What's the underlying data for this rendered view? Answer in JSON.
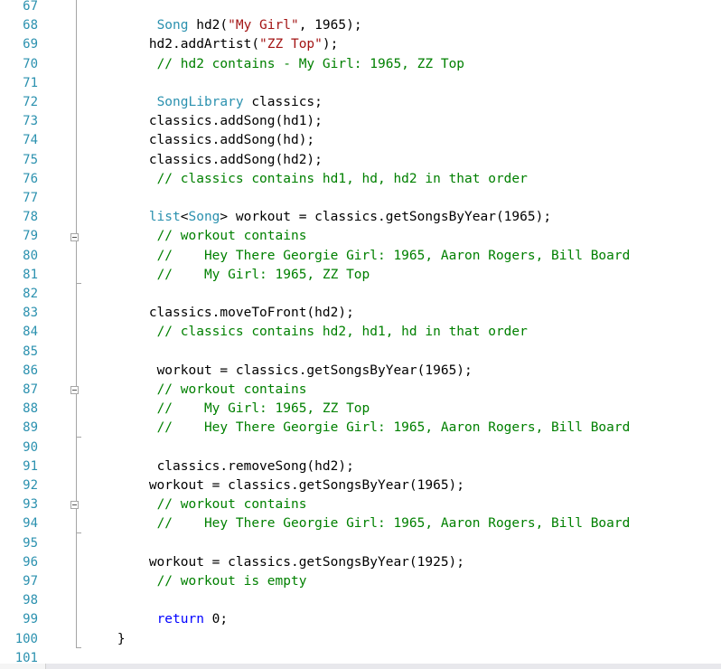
{
  "editor": {
    "lines": [
      {
        "n": "67",
        "indent": 0,
        "tokens": []
      },
      {
        "n": "68",
        "indent": 9,
        "tokens": [
          {
            "t": "Song",
            "c": "ty"
          },
          {
            "t": " hd2(",
            "c": ""
          },
          {
            "t": "\"My Girl\"",
            "c": "str"
          },
          {
            "t": ", 1965);",
            "c": ""
          }
        ]
      },
      {
        "n": "69",
        "indent": 8,
        "tokens": [
          {
            "t": "hd2.addArtist(",
            "c": ""
          },
          {
            "t": "\"ZZ Top\"",
            "c": "str"
          },
          {
            "t": ");",
            "c": ""
          }
        ]
      },
      {
        "n": "70",
        "indent": 9,
        "tokens": [
          {
            "t": "// hd2 contains - My Girl: 1965, ZZ Top",
            "c": "cm"
          }
        ]
      },
      {
        "n": "71",
        "indent": 0,
        "tokens": []
      },
      {
        "n": "72",
        "indent": 9,
        "tokens": [
          {
            "t": "SongLibrary",
            "c": "ty"
          },
          {
            "t": " classics;",
            "c": ""
          }
        ]
      },
      {
        "n": "73",
        "indent": 8,
        "tokens": [
          {
            "t": "classics.addSong(hd1);",
            "c": ""
          }
        ]
      },
      {
        "n": "74",
        "indent": 8,
        "tokens": [
          {
            "t": "classics.addSong(hd);",
            "c": ""
          }
        ]
      },
      {
        "n": "75",
        "indent": 8,
        "tokens": [
          {
            "t": "classics.addSong(hd2);",
            "c": ""
          }
        ]
      },
      {
        "n": "76",
        "indent": 9,
        "tokens": [
          {
            "t": "// classics contains hd1, hd, hd2 in that order",
            "c": "cm"
          }
        ]
      },
      {
        "n": "77",
        "indent": 0,
        "tokens": []
      },
      {
        "n": "78",
        "indent": 8,
        "tokens": [
          {
            "t": "list",
            "c": "ty"
          },
          {
            "t": "<",
            "c": ""
          },
          {
            "t": "Song",
            "c": "ty"
          },
          {
            "t": "> workout = classics.getSongsByYear(1965);",
            "c": ""
          }
        ]
      },
      {
        "n": "79",
        "indent": 9,
        "tokens": [
          {
            "t": "// workout contains",
            "c": "cm"
          }
        ]
      },
      {
        "n": "80",
        "indent": 9,
        "tokens": [
          {
            "t": "//    Hey There Georgie Girl: 1965, Aaron Rogers, Bill Board",
            "c": "cm"
          }
        ]
      },
      {
        "n": "81",
        "indent": 9,
        "tokens": [
          {
            "t": "//    My Girl: 1965, ZZ Top",
            "c": "cm"
          }
        ]
      },
      {
        "n": "82",
        "indent": 0,
        "tokens": []
      },
      {
        "n": "83",
        "indent": 8,
        "tokens": [
          {
            "t": "classics.moveToFront(hd2);",
            "c": ""
          }
        ]
      },
      {
        "n": "84",
        "indent": 9,
        "tokens": [
          {
            "t": "// classics contains hd2, hd1, hd in that order",
            "c": "cm"
          }
        ]
      },
      {
        "n": "85",
        "indent": 0,
        "tokens": []
      },
      {
        "n": "86",
        "indent": 9,
        "tokens": [
          {
            "t": "workout = classics.getSongsByYear(1965);",
            "c": ""
          }
        ]
      },
      {
        "n": "87",
        "indent": 9,
        "tokens": [
          {
            "t": "// workout contains",
            "c": "cm"
          }
        ]
      },
      {
        "n": "88",
        "indent": 9,
        "tokens": [
          {
            "t": "//    My Girl: 1965, ZZ Top",
            "c": "cm"
          }
        ]
      },
      {
        "n": "89",
        "indent": 9,
        "tokens": [
          {
            "t": "//    Hey There Georgie Girl: 1965, Aaron Rogers, Bill Board",
            "c": "cm"
          }
        ]
      },
      {
        "n": "90",
        "indent": 0,
        "tokens": []
      },
      {
        "n": "91",
        "indent": 9,
        "tokens": [
          {
            "t": "classics.removeSong(hd2);",
            "c": ""
          }
        ]
      },
      {
        "n": "92",
        "indent": 8,
        "tokens": [
          {
            "t": "workout = classics.getSongsByYear(1965);",
            "c": ""
          }
        ]
      },
      {
        "n": "93",
        "indent": 9,
        "tokens": [
          {
            "t": "// workout contains",
            "c": "cm"
          }
        ]
      },
      {
        "n": "94",
        "indent": 9,
        "tokens": [
          {
            "t": "//    Hey There Georgie Girl: 1965, Aaron Rogers, Bill Board",
            "c": "cm"
          }
        ]
      },
      {
        "n": "95",
        "indent": 0,
        "tokens": []
      },
      {
        "n": "96",
        "indent": 8,
        "tokens": [
          {
            "t": "workout = classics.getSongsByYear(1925);",
            "c": ""
          }
        ]
      },
      {
        "n": "97",
        "indent": 9,
        "tokens": [
          {
            "t": "// workout is empty",
            "c": "cm"
          }
        ]
      },
      {
        "n": "98",
        "indent": 0,
        "tokens": []
      },
      {
        "n": "99",
        "indent": 9,
        "tokens": [
          {
            "t": "return",
            "c": "kw"
          },
          {
            "t": " 0;",
            "c": ""
          }
        ]
      },
      {
        "n": "100",
        "indent": 4,
        "tokens": [
          {
            "t": "}",
            "c": ""
          }
        ]
      },
      {
        "n": "101",
        "indent": 0,
        "tokens": []
      }
    ],
    "fold_regions": [
      {
        "start_line": "79",
        "end_line": "81"
      },
      {
        "start_line": "87",
        "end_line": "89"
      },
      {
        "start_line": "93",
        "end_line": "94"
      }
    ],
    "colors": {
      "line_number": "#2b91af",
      "type": "#2b91af",
      "keyword": "#0000ff",
      "string": "#a31515",
      "comment": "#008000",
      "text": "#000000"
    }
  }
}
